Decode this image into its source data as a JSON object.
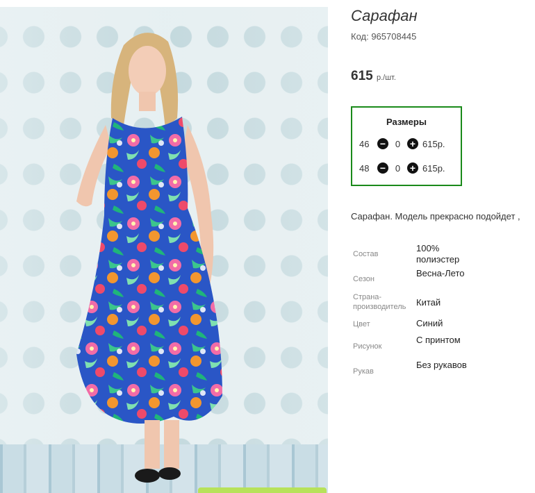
{
  "product": {
    "title": "Сарафан",
    "code": "Код: 965708445",
    "price": "615",
    "price_unit": "р./шт."
  },
  "sizes": {
    "header": "Размеры",
    "rows": [
      {
        "size": "46",
        "qty": "0",
        "price": "615р."
      },
      {
        "size": "48",
        "qty": "0",
        "price": "615р."
      }
    ]
  },
  "description": "Сарафан. Модель прекрасно подойдет ,",
  "properties": [
    {
      "key": "Состав",
      "value": "100% полиэстер"
    },
    {
      "key": "Сезон",
      "value": "Весна-Лето"
    },
    {
      "key": "Страна-производитель",
      "value": "Китай"
    },
    {
      "key": "Цвет",
      "value": "Синий"
    },
    {
      "key": "Рисунок",
      "value": "С принтом"
    },
    {
      "key": "Рукав",
      "value": "Без рукавов"
    }
  ],
  "colors": {
    "sizes_border": "#1a8a1a",
    "dress_primary": "#2a56c6",
    "accent_strip": "#b7e25a"
  }
}
